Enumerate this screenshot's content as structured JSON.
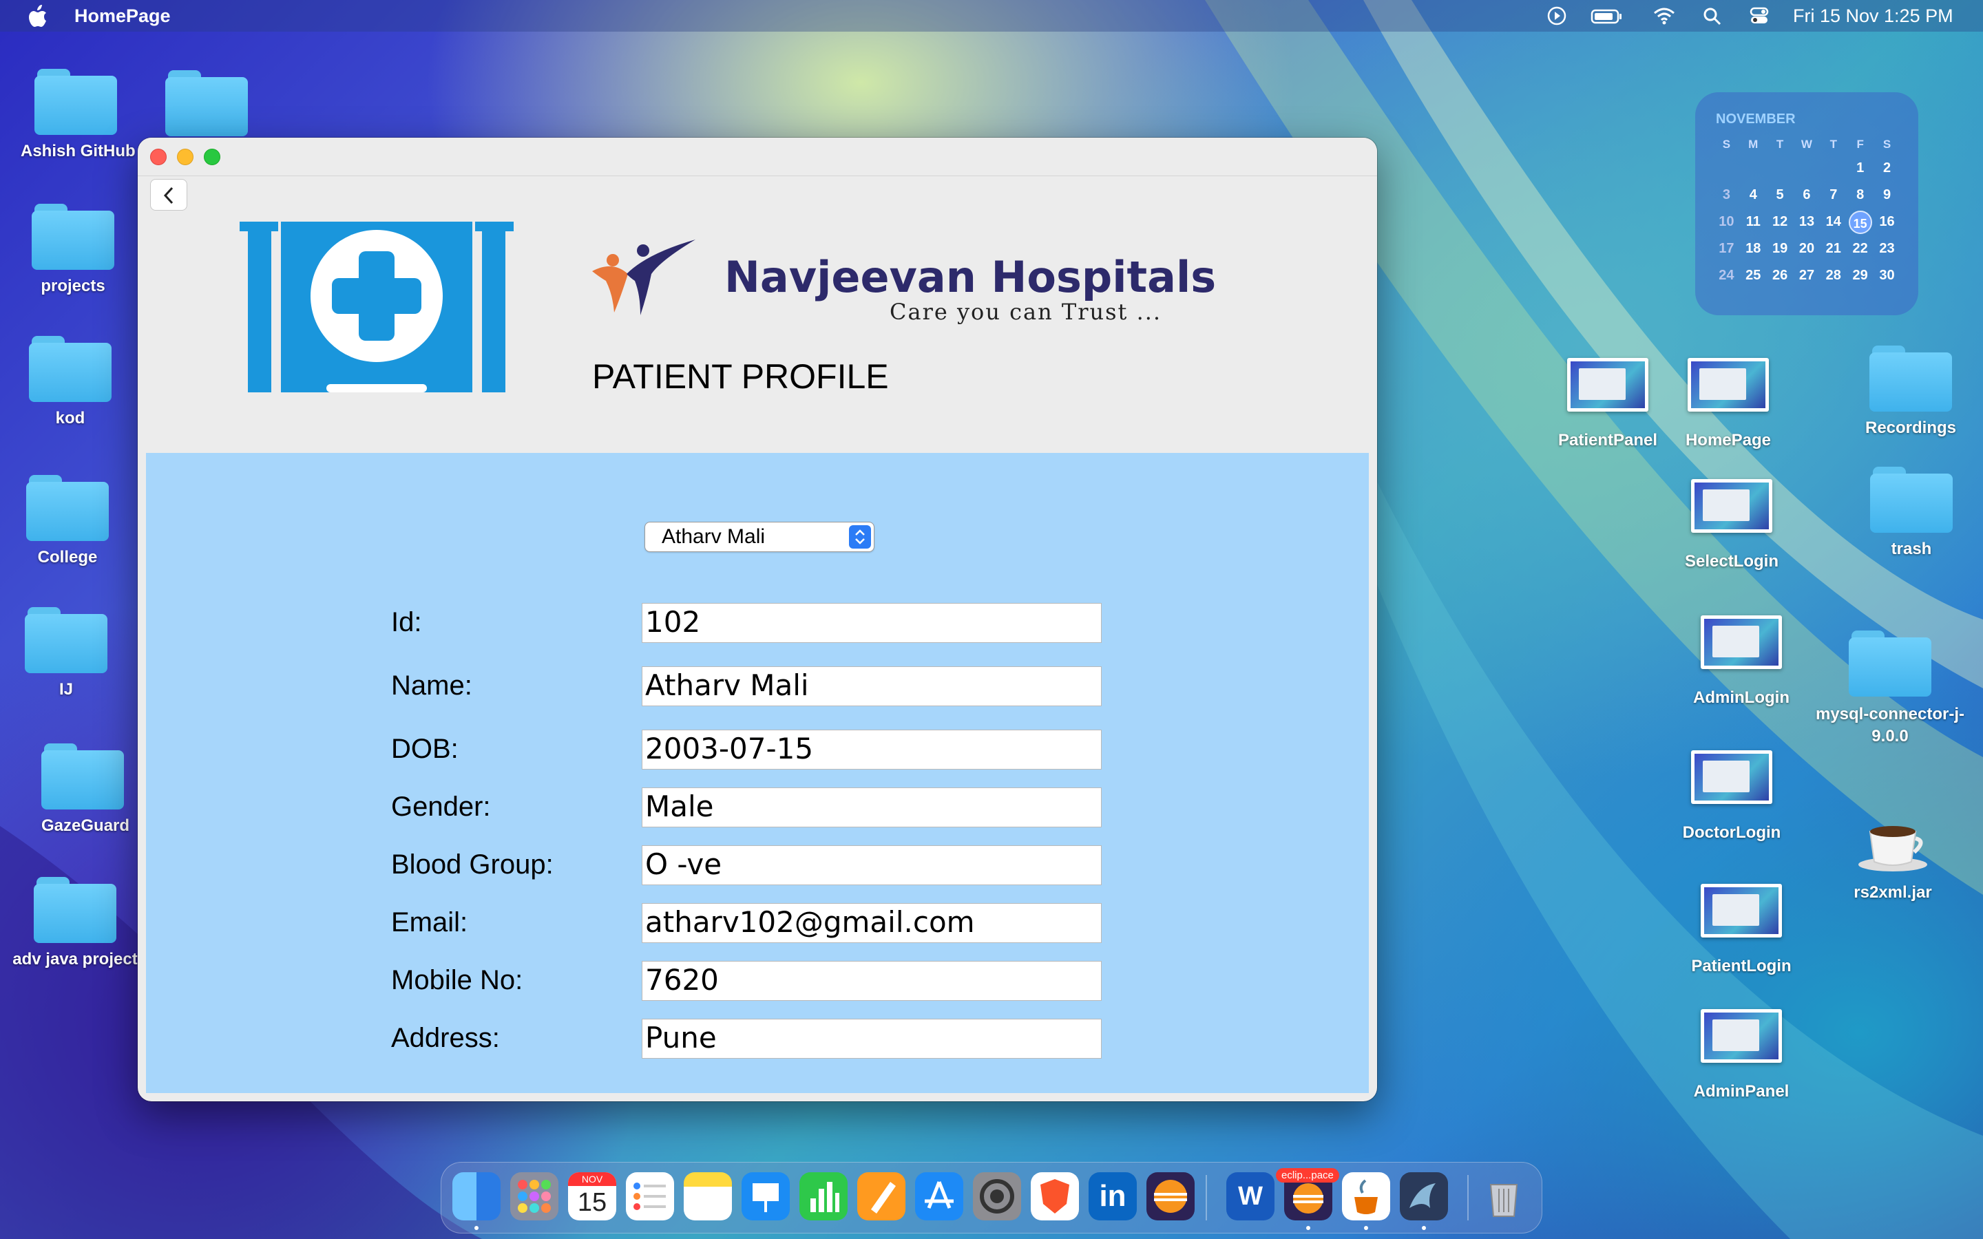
{
  "menubar": {
    "app_name": "HomePage",
    "clock": "Fri 15 Nov  1:25 PM"
  },
  "desktop_left": [
    {
      "label": "Ashish GitHub"
    },
    {
      "label": ""
    },
    {
      "label": "projects"
    },
    {
      "label": "kod"
    },
    {
      "label": "College"
    },
    {
      "label": "IJ"
    },
    {
      "label": "GazeGuard"
    },
    {
      "label": "adv java project"
    }
  ],
  "desktop_right": {
    "patient_panel": "PatientPanel",
    "home_page": "HomePage",
    "recordings": "Recordings",
    "select_login": "SelectLogin",
    "trash": "trash",
    "admin_login": "AdminLogin",
    "mysql_connector": "mysql-connector-j-9.0.0",
    "doctor_login": "DoctorLogin",
    "rs2xml": "rs2xml.jar",
    "patient_login": "PatientLogin",
    "admin_panel": "AdminPanel"
  },
  "calendar": {
    "month": "NOVEMBER",
    "days_of_week": [
      "S",
      "M",
      "T",
      "W",
      "T",
      "F",
      "S"
    ],
    "weeks": [
      [
        "",
        "",
        "",
        "",
        "",
        "1",
        "2"
      ],
      [
        "3",
        "4",
        "5",
        "6",
        "7",
        "8",
        "9"
      ],
      [
        "10",
        "11",
        "12",
        "13",
        "14",
        "15",
        "16"
      ],
      [
        "17",
        "18",
        "19",
        "20",
        "21",
        "22",
        "23"
      ],
      [
        "24",
        "25",
        "26",
        "27",
        "28",
        "29",
        "30"
      ]
    ],
    "today": "15"
  },
  "window": {
    "hospital_name": "Navjeevan Hospitals",
    "tagline": "Care you can Trust ...",
    "page_title": "PATIENT PROFILE",
    "patient_select": "Atharv Mali",
    "fields": [
      {
        "label": "Id:",
        "value": "102"
      },
      {
        "label": "Name:",
        "value": "Atharv Mali"
      },
      {
        "label": "DOB:",
        "value": "2003-07-15"
      },
      {
        "label": "Gender:",
        "value": "Male"
      },
      {
        "label": "Blood Group:",
        "value": "O -ve"
      },
      {
        "label": "Email:",
        "value": "atharv102@gmail.com"
      },
      {
        "label": "Mobile No:",
        "value": "7620"
      },
      {
        "label": "Address:",
        "value": "Pune"
      }
    ]
  },
  "dock": {
    "calendar_month": "NOV",
    "calendar_day": "15",
    "eclipse_badge": "eclip...pace",
    "word_letter": "W",
    "linkedin_text": "in"
  },
  "colors": {
    "panel_bg": "#a7d6fb",
    "brand_navy": "#2d2a6b",
    "medical_blue": "#1a96dc"
  }
}
